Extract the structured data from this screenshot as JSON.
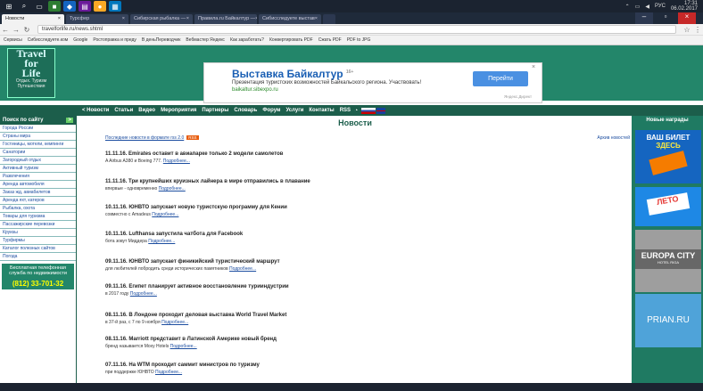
{
  "taskbar": {
    "tray_lang": "РУС",
    "time": "17:31",
    "date": "06.02.2017"
  },
  "tabs": [
    {
      "label": "Новости",
      "active": true
    },
    {
      "label": "Турсфер",
      "active": false
    },
    {
      "label": "Сибирская рыбалка —",
      "active": false
    },
    {
      "label": "Правила.ru Байкалтур —",
      "active": false
    },
    {
      "label": "Сибисследуете выстав",
      "active": false
    }
  ],
  "browser": {
    "url": "travelforlife.ru/news.shtml"
  },
  "bookmarks": [
    "Сервисы",
    "Сибисследуете.ком",
    "Google",
    "Ростоправка и преду",
    "В деньПереводчик",
    "Вебмастер Яндекс",
    "Как заработать?",
    "Конвертировать PDF",
    "Сжать PDF",
    "PDF to JPG"
  ],
  "logo": {
    "line1": "Travel",
    "line2": "for",
    "line3": "Life",
    "sub1": "Отдых. Туризм",
    "sub2": "Путешествия"
  },
  "ad": {
    "title": "Выставка Байкалтур",
    "title_suffix": "16+",
    "text": "Презентация туристских возможностей Байкальского региона. Участвовать!",
    "url": "baikaltur.sibexpo.ru",
    "button": "Перейти",
    "close": "×",
    "small": "Яндекс.Директ"
  },
  "navbar": {
    "items": [
      "< Новости",
      "Статьи",
      "Видео",
      "Мероприятия",
      "Партнеры",
      "Словарь",
      "Форум",
      "Услуги",
      "Контакты",
      "RSS"
    ]
  },
  "sidebar": {
    "title": "Поиск по сайту",
    "arrow": ">",
    "items": [
      "Города России",
      "Страны мира",
      "Гостиницы, мотели, кемпинги",
      "Санатории",
      "Загородный отдых",
      "Активный туризм",
      "Развлечения",
      "Аренда автомобиля",
      "Заказ жд, авиабилетов",
      "Аренда яхт, катеров",
      "Рыбалка, охота",
      "Товары для туризма",
      "Пассажирские перевозки",
      "Круизы",
      "Турфирмы",
      "Каталог полезных сайтов",
      "Погода"
    ],
    "help": "Бесплатная телефонная служба по недвижимости",
    "phone": "(812) 33-701-32"
  },
  "content": {
    "title": "Новости",
    "top_link": "Последние новости в формате rss 2.0",
    "rss_badge": "RSS",
    "all_link": "Архив новостей",
    "news": [
      {
        "title": "11.11.16. Emirates оставит в авиапарке только 2 модели самолетов",
        "summary": "A Airbus A380 и Boeing 777.",
        "more": "Подробнее..."
      },
      {
        "title": "11.11.16. Три крупнейших круизных лайнера в мире отправились в плавание",
        "summary": "впервые - одновременно",
        "more": "Подробнее..."
      },
      {
        "title": "10.11.16. ЮНВТО запускает новую туристскую программу для Кении",
        "summary": "совместно с Amadeus",
        "more": "Подробнее..."
      },
      {
        "title": "10.11.16. Lufthansa запустила чатбота для Facebook",
        "summary": "бота зовут Миддера",
        "more": "Подробнее..."
      },
      {
        "title": "09.11.16. ЮНВТО запускает финикийский туристический маршрут",
        "summary": "для любителей побродить среди исторических памятников",
        "more": "Подробнее..."
      },
      {
        "title": "09.11.16. Египет планирует активное восстановление турииндустрии",
        "summary": "в 2017 году",
        "more": "Подробнее..."
      },
      {
        "title": "08.11.16. В Лондоне проходит деловая выставка World Travel Market",
        "summary": "в 37-й раз, с 7 по 9 ноября",
        "more": "Подробнее..."
      },
      {
        "title": "08.11.16. Marriott представит в Латинской Америке новый бренд",
        "summary": "бренд называется Moxy Hotels",
        "more": "Подробнее..."
      },
      {
        "title": "07.11.16. На WTM проходит саммит министров по туризму",
        "summary": "при поддержке ЮНВТО",
        "more": "Подробнее..."
      }
    ]
  },
  "right": {
    "title": "Новые награды",
    "b1_line1": "ВАШ БИЛЕТ",
    "b1_line2": "ЗДЕСЬ",
    "b2": "ЛЕТО",
    "b3": "EUROPA CITY",
    "b3_sub": "HOTEL RIGA",
    "b4": "PRIAN.RU"
  }
}
